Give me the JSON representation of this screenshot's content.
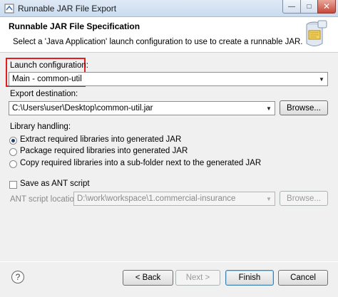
{
  "window": {
    "title": "Runnable JAR File Export",
    "minimize_glyph": "—",
    "maximize_glyph": "□",
    "close_glyph": "✕"
  },
  "header": {
    "title": "Runnable JAR File Specification",
    "description": "Select a 'Java Application' launch configuration to use to create a runnable JAR."
  },
  "launch": {
    "label": "Launch configuration:",
    "selected": "Main - common-util",
    "highlight_color": "#e02020"
  },
  "export": {
    "label": "Export destination:",
    "value": "C:\\Users\\user\\Desktop\\common-util.jar",
    "browse_label": "Browse..."
  },
  "library": {
    "label": "Library handling:",
    "options": [
      {
        "label": "Extract required libraries into generated JAR",
        "checked": true
      },
      {
        "label": "Package required libraries into generated JAR",
        "checked": false
      },
      {
        "label": "Copy required libraries into a sub-folder next to the generated JAR",
        "checked": false
      }
    ]
  },
  "ant": {
    "save_label": "Save as ANT script",
    "location_label": "ANT script location:",
    "location_value": "D:\\work\\workspace\\1.commercial-insurance",
    "browse_label": "Browse..."
  },
  "footer": {
    "help_glyph": "?",
    "back_label": "< Back",
    "next_label": "Next >",
    "finish_label": "Finish",
    "cancel_label": "Cancel"
  }
}
